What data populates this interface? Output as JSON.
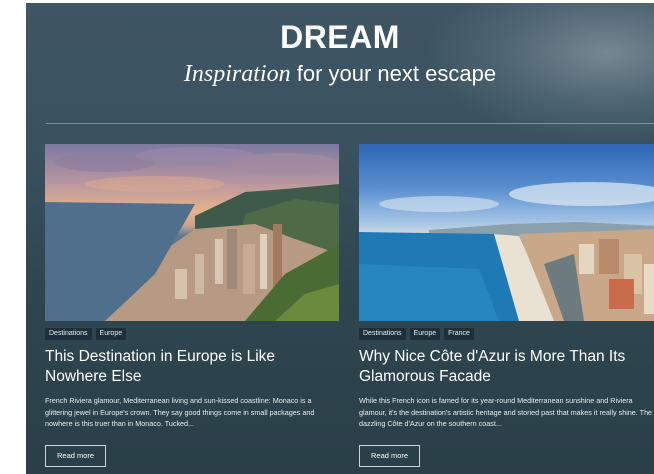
{
  "header": {
    "title": "DREAM",
    "subtitle_em": "Inspiration",
    "subtitle_rest": " for your next escape"
  },
  "cards": [
    {
      "tags": [
        "Destinations",
        "Europe"
      ],
      "title": "This Destination in Europe is Like Nowhere Else",
      "description": "French Riviera glamour, Mediterranean living and sun-kissed coastline: Monaco is a glittering jewel in Europe's crown. They say good things come in small packages and nowhere is this truer than in Monaco. Tucked...",
      "button": "Read more"
    },
    {
      "tags": [
        "Destinations",
        "Europe",
        "France"
      ],
      "title": "Why Nice Côte d'Azur is More Than Its Glamorous Facade",
      "description": "While this French icon is famed for its year-round Mediterranean sunshine and Riviera glamour, it's the destination's artistic heritage and storied past that makes it really shine. The dazzling Côte d'Azur on the southern coast...",
      "button": "Read more"
    }
  ]
}
